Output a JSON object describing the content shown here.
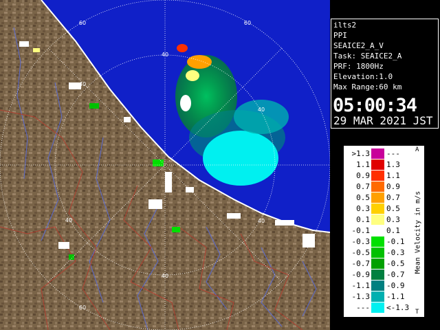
{
  "info_panel": {
    "lines": [
      "ilts2",
      "PPI",
      "SEAICE2_A_V",
      "Task: SEAICE2_A",
      "PRF: 1800Hz",
      "Elevation:1.0",
      "Max Range:60 km"
    ],
    "time": "05:00:34",
    "date": "29 MAR 2021 JST"
  },
  "range_ring_labels": [
    "60",
    "60",
    "40",
    "40",
    "40",
    "40",
    "40",
    "40",
    "60"
  ],
  "legend": {
    "title": "Mean Velocity in m/s",
    "corner_top": "A",
    "corner_bottom": "T",
    "rows": [
      {
        "left": ">1.3",
        "color": "#c8009a",
        "right": "---"
      },
      {
        "left": "1.1",
        "color": "#e00000",
        "right": "1.3"
      },
      {
        "left": "0.9",
        "color": "#ff3000",
        "right": "1.1"
      },
      {
        "left": "0.7",
        "color": "#ff6a00",
        "right": "0.9"
      },
      {
        "left": "0.5",
        "color": "#ffa000",
        "right": "0.7"
      },
      {
        "left": "0.3",
        "color": "#ffd000",
        "right": "0.5"
      },
      {
        "left": "0.1",
        "color": "#ffff80",
        "right": "0.3"
      },
      {
        "left": "-0.1",
        "color": "#ffffff",
        "right": "0.1"
      },
      {
        "left": "-0.3",
        "color": "#00e000",
        "right": "-0.1"
      },
      {
        "left": "-0.5",
        "color": "#00c000",
        "right": "-0.3"
      },
      {
        "left": "-0.7",
        "color": "#00a000",
        "right": "-0.5"
      },
      {
        "left": "-0.9",
        "color": "#008040",
        "right": "-0.7"
      },
      {
        "left": "-1.1",
        "color": "#008080",
        "right": "-0.9"
      },
      {
        "left": "-1.3",
        "color": "#00b0b0",
        "right": "-1.1"
      },
      {
        "left": "---",
        "color": "#00f0f0",
        "right": "<-1.3"
      }
    ]
  },
  "colors": {
    "sea": "#1020c8",
    "land": "#7a6448",
    "river": "#5a6ad0",
    "boundary": "#b04030",
    "range_ring": "#ffffff"
  }
}
